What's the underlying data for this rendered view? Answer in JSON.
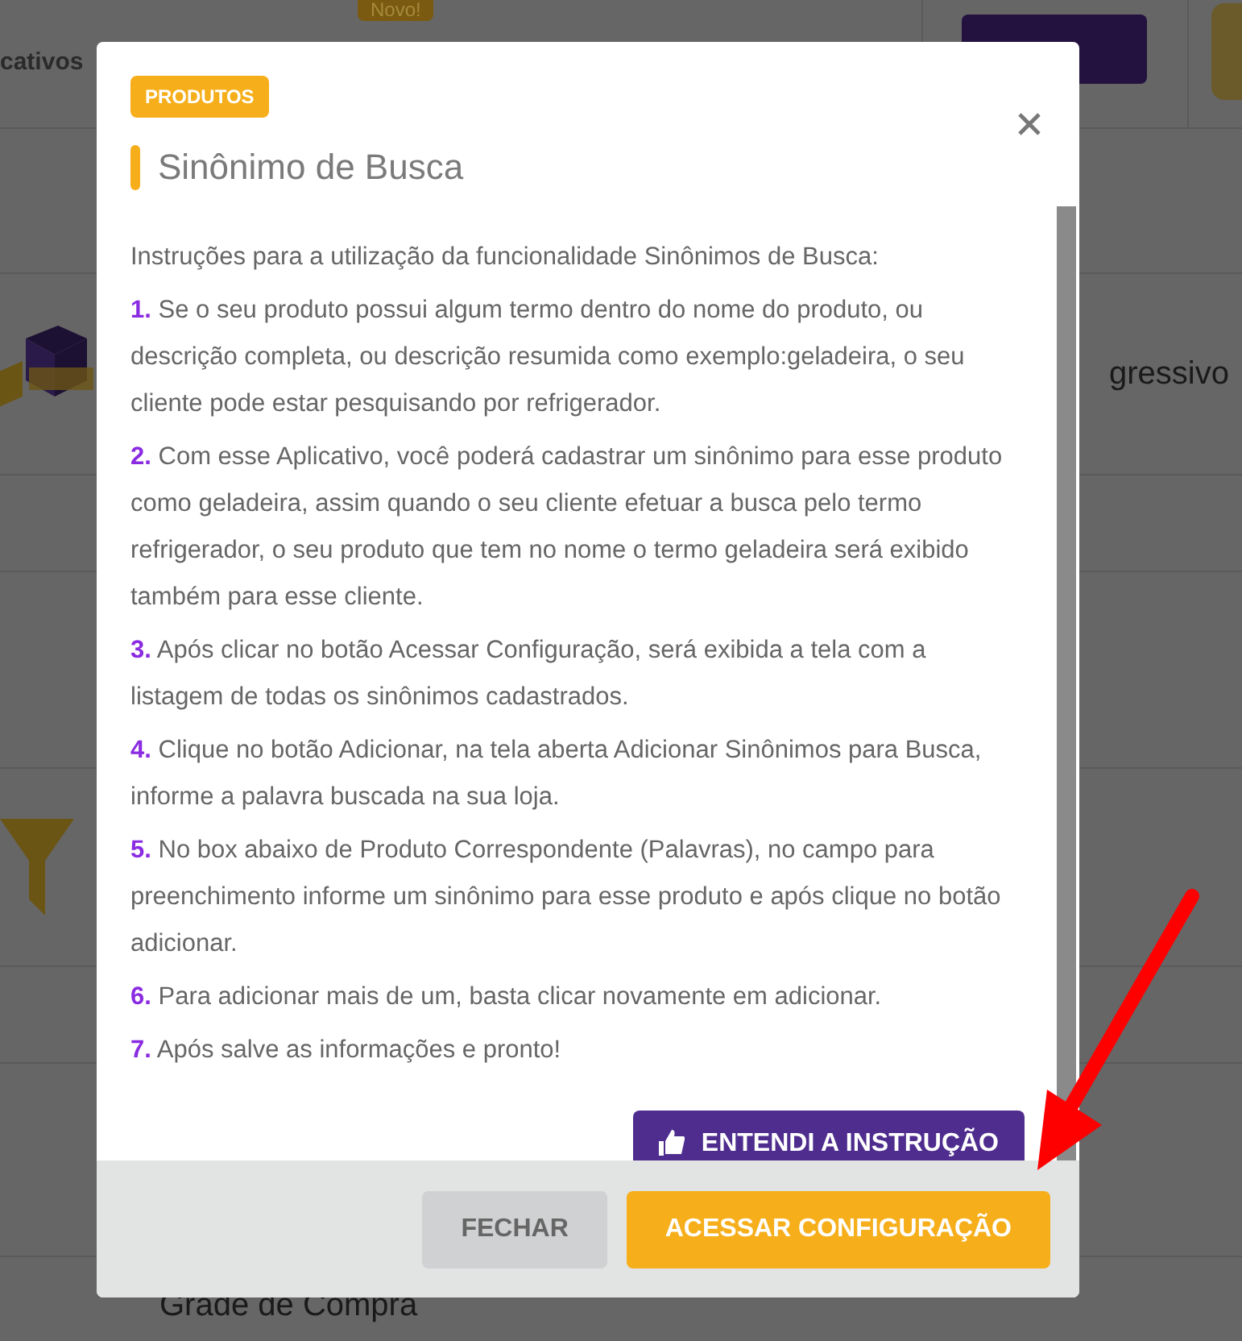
{
  "background": {
    "header": {
      "menu_text": "cativos",
      "new_badge": "Novo!"
    },
    "rows": [
      {
        "kind": "plain"
      },
      {
        "kind": "logo",
        "text": "gressivo"
      },
      {
        "kind": "plain"
      },
      {
        "kind": "plain"
      },
      {
        "kind": "funnel"
      },
      {
        "kind": "plain"
      },
      {
        "kind": "plain"
      },
      {
        "kind": "plain",
        "text": "Grade de Compra"
      }
    ]
  },
  "modal": {
    "tag": "PRODUTOS",
    "title": "Sinônimo de Busca",
    "intro": "Instruções para a utilização da funcionalidade Sinônimos de Busca:",
    "steps": [
      {
        "number": "1.",
        "text": "Se o seu produto possui algum termo dentro do nome do produto, ou descrição completa, ou descrição resumida como exemplo:geladeira, o seu cliente pode estar pesquisando por refrigerador."
      },
      {
        "number": "2.",
        "text": "Com esse Aplicativo, você poderá cadastrar um sinônimo para esse produto como geladeira, assim quando o seu cliente efetuar a busca pelo termo refrigerador, o seu produto que tem no nome o termo geladeira será exibido também para esse cliente."
      },
      {
        "number": "3.",
        "text": "Após clicar no botão Acessar Configuração, será exibida a tela com a listagem de todas os sinônimos cadastrados."
      },
      {
        "number": "4.",
        "text": "Clique no botão Adicionar, na tela aberta Adicionar Sinônimos para Busca, informe a palavra buscada na sua loja."
      },
      {
        "number": "5.",
        "text": "No box abaixo de Produto Correspondente (Palavras), no campo para preenchimento informe um sinônimo para esse produto e após clique no botão adicionar."
      },
      {
        "number": "6.",
        "text": "Para adicionar mais de um, basta clicar novamente em adicionar."
      },
      {
        "number": "7.",
        "text": "Após salve as informações e pronto!"
      }
    ],
    "understood_button": "ENTENDI A INSTRUÇÃO",
    "buttons": [
      {
        "label": "FECHAR",
        "kind": "secondary"
      },
      {
        "label": "ACESSAR CONFIGURAÇÃO",
        "kind": "primary"
      }
    ]
  }
}
